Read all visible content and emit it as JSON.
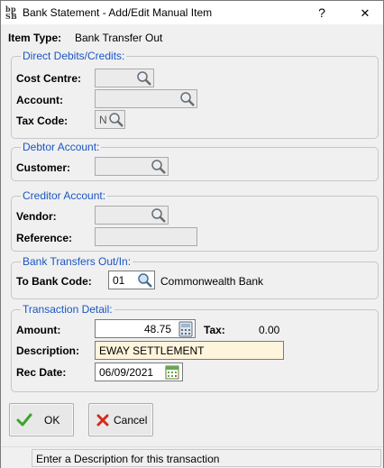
{
  "window": {
    "title": "Bank Statement - Add/Edit Manual Item",
    "help_label": "?",
    "close_label": "✕",
    "icon_text": "ѣS"
  },
  "item_type": {
    "label": "Item Type:",
    "value": "Bank Transfer Out"
  },
  "direct_debits": {
    "title": "Direct Debits/Credits:",
    "cost_centre_label": "Cost Centre:",
    "cost_centre_value": "",
    "account_label": "Account:",
    "account_value": "",
    "tax_code_label": "Tax Code:",
    "tax_code_value": "N"
  },
  "debtor": {
    "title": "Debtor Account:",
    "customer_label": "Customer:",
    "customer_value": ""
  },
  "creditor": {
    "title": "Creditor Account:",
    "vendor_label": "Vendor:",
    "vendor_value": "",
    "reference_label": "Reference:",
    "reference_value": ""
  },
  "bank_transfers": {
    "title": "Bank Transfers Out/In:",
    "to_bank_code_label": "To Bank Code:",
    "to_bank_code_value": "01",
    "bank_name": "Commonwealth Bank"
  },
  "transaction": {
    "title": "Transaction Detail:",
    "amount_label": "Amount:",
    "amount_value": "48.75",
    "tax_label": "Tax:",
    "tax_value": "0.00",
    "description_label": "Description:",
    "description_value": "EWAY SETTLEMENT",
    "rec_date_label": "Rec Date:",
    "rec_date_value": "06/09/2021"
  },
  "buttons": {
    "ok_label": "OK",
    "cancel_label": "Cancel"
  },
  "status": {
    "message": "Enter a Description for this transaction"
  },
  "colors": {
    "group_title": "#1a56c4",
    "description_bg": "#fff4dc",
    "ok_check": "#3aa52c",
    "cancel_x": "#d42b1e"
  },
  "icons": [
    "app-icon",
    "help-icon",
    "close-icon",
    "magnifier-icon",
    "calculator-icon",
    "calendar-icon",
    "check-icon",
    "cancel-x-icon"
  ]
}
